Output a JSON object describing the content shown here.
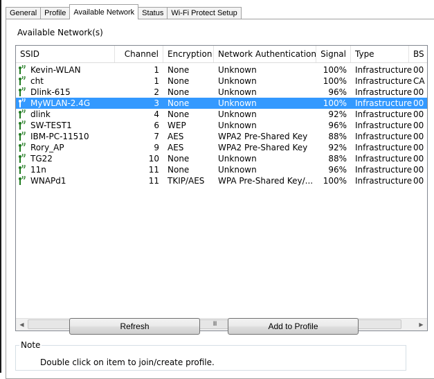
{
  "tabs": [
    "General",
    "Profile",
    "Available Network",
    "Status",
    "Wi-Fi Protect Setup"
  ],
  "active_tab": "Available Network",
  "group_label": "Available Network(s)",
  "columns": [
    "SSID",
    "Channel",
    "Encryption",
    "Network Authentication",
    "Signal",
    "Type",
    "BS"
  ],
  "rows": [
    {
      "ssid": "Kevin-WLAN",
      "channel": "1",
      "encryption": "None",
      "auth": "Unknown",
      "signal": "100%",
      "type": "Infrastructure",
      "bssid": "00"
    },
    {
      "ssid": "cht",
      "channel": "1",
      "encryption": "None",
      "auth": "Unknown",
      "signal": "100%",
      "type": "Infrastructure",
      "bssid": "CA"
    },
    {
      "ssid": "Dlink-615",
      "channel": "2",
      "encryption": "None",
      "auth": "Unknown",
      "signal": "96%",
      "type": "Infrastructure",
      "bssid": "00"
    },
    {
      "ssid": "MyWLAN-2.4G",
      "channel": "3",
      "encryption": "None",
      "auth": "Unknown",
      "signal": "100%",
      "type": "Infrastructure",
      "bssid": "00",
      "selected": true
    },
    {
      "ssid": "dlink",
      "channel": "4",
      "encryption": "None",
      "auth": "Unknown",
      "signal": "92%",
      "type": "Infrastructure",
      "bssid": "00"
    },
    {
      "ssid": "SW-TEST1",
      "channel": "6",
      "encryption": "WEP",
      "auth": "Unknown",
      "signal": "96%",
      "type": "Infrastructure",
      "bssid": "00"
    },
    {
      "ssid": "IBM-PC-11510",
      "channel": "7",
      "encryption": "AES",
      "auth": "WPA2 Pre-Shared Key",
      "signal": "88%",
      "type": "Infrastructure",
      "bssid": "00"
    },
    {
      "ssid": "Rory_AP",
      "channel": "9",
      "encryption": "AES",
      "auth": "WPA2 Pre-Shared Key",
      "signal": "92%",
      "type": "Infrastructure",
      "bssid": "00"
    },
    {
      "ssid": "TG22",
      "channel": "10",
      "encryption": "None",
      "auth": "Unknown",
      "signal": "88%",
      "type": "Infrastructure",
      "bssid": "00"
    },
    {
      "ssid": "11n",
      "channel": "11",
      "encryption": "None",
      "auth": "Unknown",
      "signal": "96%",
      "type": "Infrastructure",
      "bssid": "00"
    },
    {
      "ssid": "WNAPd1",
      "channel": "11",
      "encryption": "TKIP/AES",
      "auth": "WPA Pre-Shared Key/...",
      "signal": "100%",
      "type": "Infrastructure",
      "bssid": "00"
    }
  ],
  "icons": {
    "network": "wifi-signal-icon",
    "scroll_left": "scroll-left-arrow-icon",
    "scroll_right": "scroll-right-arrow-icon"
  },
  "scrollbar_grip": "III",
  "buttons": {
    "refresh": "Refresh",
    "add_to_profile": "Add to Profile"
  },
  "note": {
    "legend": "Note",
    "text": "Double click on item to join/create profile."
  },
  "colors": {
    "selection": "#3399ff",
    "signal_icon": "#1f7a1f"
  }
}
